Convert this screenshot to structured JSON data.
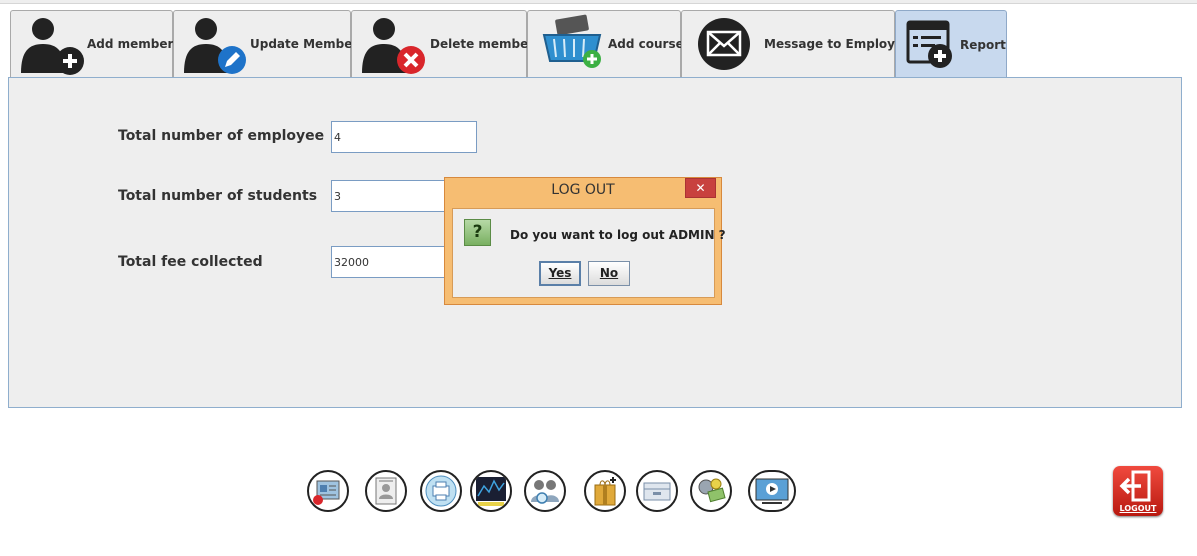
{
  "tabs": [
    {
      "label": "Add member",
      "icon": "add-member-icon"
    },
    {
      "label": "Update Member",
      "icon": "update-member-icon"
    },
    {
      "label": "Delete member",
      "icon": "delete-member-icon"
    },
    {
      "label": "Add course",
      "icon": "add-course-icon"
    },
    {
      "label": "Message to Employee",
      "icon": "message-icon"
    },
    {
      "label": "Report",
      "icon": "report-icon",
      "active": true
    }
  ],
  "report": {
    "employees_label": "Total number of employee",
    "employees_value": "4",
    "students_label": "Total number of students",
    "students_value": "3",
    "fee_label": "Total fee collected",
    "fee_value": "32000"
  },
  "dialog": {
    "title": "LOG OUT",
    "close": "✕",
    "icon_glyph": "?",
    "message": "Do you want to log out ADMIN ?",
    "yes_label": "Yes",
    "no_label": "No"
  },
  "bottom_icons": [
    "admission-form-icon",
    "id-card-icon",
    "printer-icon",
    "chart-icon",
    "search-people-icon",
    "gift-box-icon",
    "drawer-icon",
    "money-icon",
    "video-icon"
  ],
  "logout_label": "LOGOUT",
  "colors": {
    "dialog_header": "#f6bd72",
    "active_tab": "#c8d9ee",
    "close_button": "#c8413e",
    "logout_button": "#e0281f"
  }
}
